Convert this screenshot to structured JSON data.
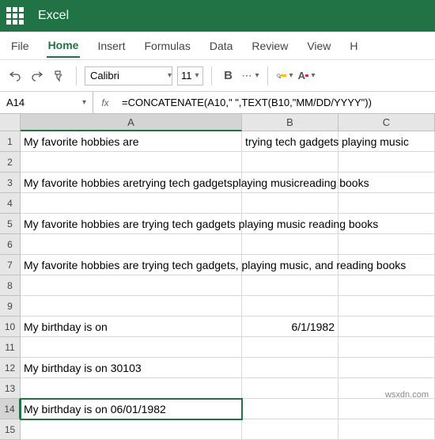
{
  "app": {
    "name": "Excel"
  },
  "menu": {
    "file": "File",
    "home": "Home",
    "insert": "Insert",
    "formulas": "Formulas",
    "data": "Data",
    "review": "Review",
    "view": "View",
    "h": "H"
  },
  "toolbar": {
    "font": "Calibri",
    "size": "11",
    "bold": "B"
  },
  "namebox": "A14",
  "fx_label": "fx",
  "formula": "=CONCATENATE(A10,\" \",TEXT(B10,\"MM/DD/YYYY\"))",
  "columns": {
    "a": "A",
    "b": "B",
    "c": "C"
  },
  "cells": {
    "r1": {
      "a": "My favorite hobbies are",
      "b": "trying tech gadgets",
      "c": "playing music"
    },
    "r3": {
      "a": "My favorite hobbies aretrying tech gadgetsplaying musicreading books"
    },
    "r5": {
      "a": "My favorite hobbies are trying tech gadgets playing music reading books"
    },
    "r7": {
      "a": "My favorite hobbies are trying tech gadgets, playing music, and reading books"
    },
    "r10": {
      "a": "My birthday is on",
      "b": "6/1/1982"
    },
    "r12": {
      "a": "My birthday is on 30103"
    },
    "r14": {
      "a": "My birthday is on 06/01/1982"
    }
  },
  "rows": [
    "1",
    "2",
    "3",
    "4",
    "5",
    "6",
    "7",
    "8",
    "9",
    "10",
    "11",
    "12",
    "13",
    "14",
    "15"
  ],
  "watermark": "wsxdn.com",
  "colors": {
    "brand": "#217346",
    "highlight": "#ffff00",
    "fill": "#ffc000",
    "font_red": "#d13438"
  }
}
